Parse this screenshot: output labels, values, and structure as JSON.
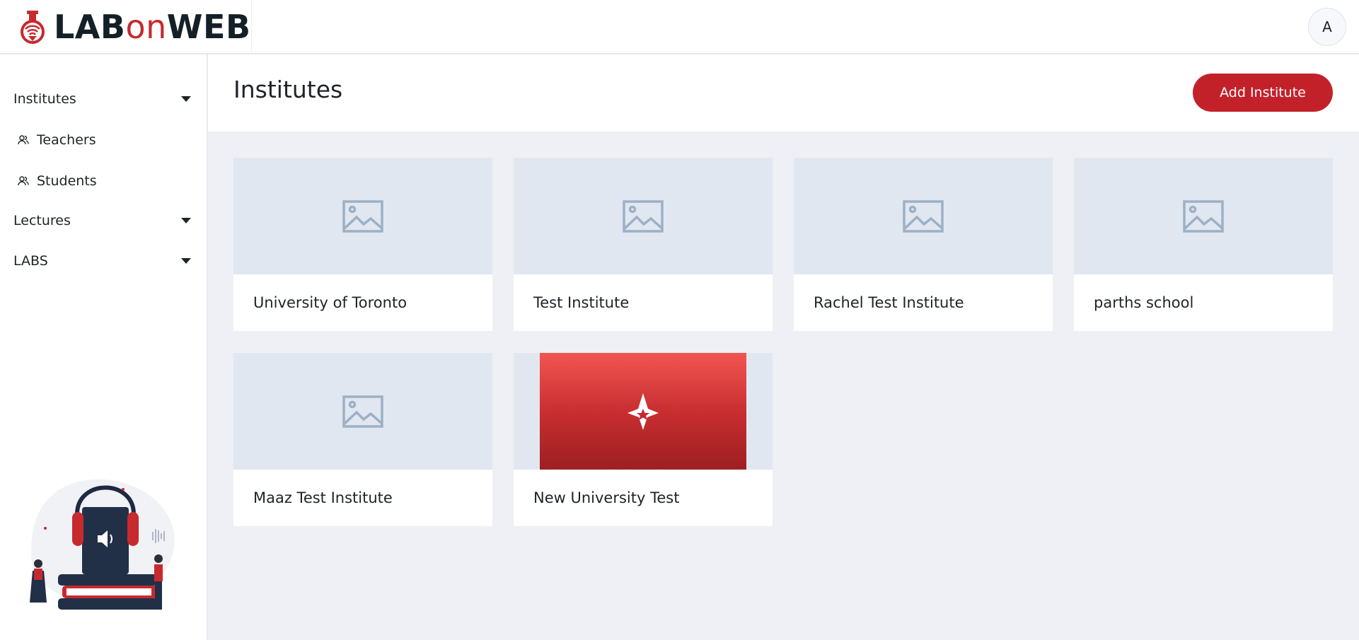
{
  "app": {
    "logo_parts": [
      "LAB",
      "on",
      "WEB"
    ],
    "brand_color": "#c3212a"
  },
  "header": {
    "avatar_initial": "A"
  },
  "sidebar": {
    "items": [
      {
        "label": "Institutes",
        "type": "dropdown"
      },
      {
        "label": "Teachers",
        "type": "link",
        "icon": "users-icon"
      },
      {
        "label": "Students",
        "type": "link",
        "icon": "users-icon"
      },
      {
        "label": "Lectures",
        "type": "dropdown"
      },
      {
        "label": "LABS",
        "type": "dropdown"
      }
    ]
  },
  "main": {
    "title": "Institutes",
    "add_button_label": "Add Institute",
    "cards": [
      {
        "name": "University of Toronto",
        "image": "placeholder-image-icon"
      },
      {
        "name": "Test Institute",
        "image": "placeholder-image-icon"
      },
      {
        "name": "Rachel Test Institute",
        "image": "placeholder-image-icon"
      },
      {
        "name": "parths school",
        "image": "placeholder-image-icon"
      },
      {
        "name": "Maaz Test Institute",
        "image": "placeholder-image-icon"
      },
      {
        "name": "New University Test",
        "image": "institute-logo-star"
      }
    ]
  }
}
